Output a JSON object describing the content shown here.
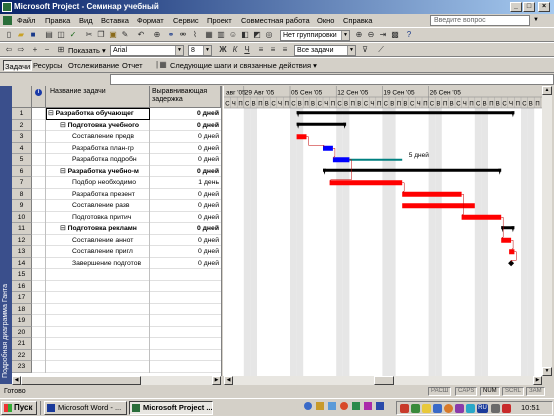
{
  "window": {
    "title": "Microsoft Project - Семинар учебный",
    "min": "_",
    "max": "□",
    "close": "×"
  },
  "menu": {
    "items": [
      "Файл",
      "Правка",
      "Вид",
      "Вставка",
      "Формат",
      "Сервис",
      "Проект",
      "Совместная работа",
      "Окно",
      "Справка"
    ],
    "ask_placeholder": "Введите вопрос"
  },
  "toolbar1": {
    "grouping": "Нет группировки"
  },
  "toolbar2": {
    "show_label": "Показать",
    "font": "Arial",
    "size": "8",
    "filter": "Все задачи"
  },
  "toolbar3": {
    "items": [
      "Задачи",
      "Ресурсы",
      "Отслеживание",
      "Отчет"
    ],
    "next_steps": "Следующие шаги и связанные действия"
  },
  "view_label": "Подробная диаграмма Ганта",
  "table": {
    "col_info": "i",
    "col_name": "Название задачи",
    "col_slack": "Выравнивающая задержка",
    "rows": [
      {
        "n": "1",
        "name": "Разработка обучающег",
        "slack": "0 дней",
        "level": 0,
        "summary": true
      },
      {
        "n": "2",
        "name": "Подготовка учебного",
        "slack": "0 дней",
        "level": 1,
        "summary": true
      },
      {
        "n": "3",
        "name": "Составление предв",
        "slack": "0 дней",
        "level": 2,
        "summary": false
      },
      {
        "n": "4",
        "name": "Разработка план-гр",
        "slack": "0 дней",
        "level": 2,
        "summary": false
      },
      {
        "n": "5",
        "name": "Разработка подробн",
        "slack": "0 дней",
        "level": 2,
        "summary": false
      },
      {
        "n": "6",
        "name": "Разработка учебно-м",
        "slack": "0 дней",
        "level": 1,
        "summary": true
      },
      {
        "n": "7",
        "name": "Подбор необходимо",
        "slack": "1 день",
        "level": 2,
        "summary": false
      },
      {
        "n": "8",
        "name": "Разработка презент",
        "slack": "0 дней",
        "level": 2,
        "summary": false
      },
      {
        "n": "9",
        "name": "Составление разв",
        "slack": "0 дней",
        "level": 2,
        "summary": false
      },
      {
        "n": "10",
        "name": "Подготовка притич",
        "slack": "0 дней",
        "level": 2,
        "summary": false
      },
      {
        "n": "11",
        "name": "Подготовка рекламн",
        "slack": "0 дней",
        "level": 1,
        "summary": true
      },
      {
        "n": "12",
        "name": "Составление аннот",
        "slack": "0 дней",
        "level": 2,
        "summary": false
      },
      {
        "n": "13",
        "name": "Составление пригл",
        "slack": "0 дней",
        "level": 2,
        "summary": false
      },
      {
        "n": "14",
        "name": "Завершение подготов",
        "slack": "0 дней",
        "level": 2,
        "summary": false
      },
      {
        "n": "15",
        "name": "",
        "slack": "",
        "level": 0,
        "summary": false
      },
      {
        "n": "16",
        "name": "",
        "slack": "",
        "level": 0,
        "summary": false
      },
      {
        "n": "17",
        "name": "",
        "slack": "",
        "level": 0,
        "summary": false
      },
      {
        "n": "18",
        "name": "",
        "slack": "",
        "level": 0,
        "summary": false
      },
      {
        "n": "19",
        "name": "",
        "slack": "",
        "level": 0,
        "summary": false
      },
      {
        "n": "20",
        "name": "",
        "slack": "",
        "level": 0,
        "summary": false
      },
      {
        "n": "21",
        "name": "",
        "slack": "",
        "level": 0,
        "summary": false
      },
      {
        "n": "22",
        "name": "",
        "slack": "",
        "level": 0,
        "summary": false
      },
      {
        "n": "23",
        "name": "",
        "slack": "",
        "level": 0,
        "summary": false
      }
    ]
  },
  "gantt": {
    "weeks": [
      "авг '05",
      "29 Авг '05",
      "05 Сен '05",
      "12 Сен '05",
      "19 Сен '05",
      "26 Сен '05"
    ],
    "days": [
      "С",
      "Ч",
      "П",
      "С",
      "В",
      "П",
      "В",
      "С",
      "Ч",
      "П",
      "С",
      "В",
      "П",
      "В",
      "С",
      "Ч",
      "П",
      "С",
      "В",
      "П",
      "В",
      "С",
      "Ч",
      "П",
      "С",
      "В",
      "П",
      "В",
      "С",
      "Ч",
      "П",
      "С",
      "В",
      "П",
      "В",
      "С",
      "Ч",
      "П",
      "С",
      "В",
      "П",
      "В",
      "С",
      "Ч",
      "П",
      "С",
      "В",
      "П"
    ],
    "slack_label": "5 дней",
    "colors": {
      "critical": "#ff0000",
      "normal": "#0000ff",
      "summary": "#000000",
      "slack": "#008080",
      "weekend": "#e6e6e6"
    }
  },
  "status": {
    "ready": "Готово",
    "indicators": [
      "РАСШ",
      "CAPS",
      "NUM",
      "SCRL",
      "ЗАМ"
    ]
  },
  "taskbar": {
    "start": "Пуск",
    "buttons": [
      {
        "label": "Microsoft Word - ...",
        "active": false
      },
      {
        "label": "Microsoft Project ...",
        "active": true
      }
    ],
    "clock": "10:51"
  }
}
